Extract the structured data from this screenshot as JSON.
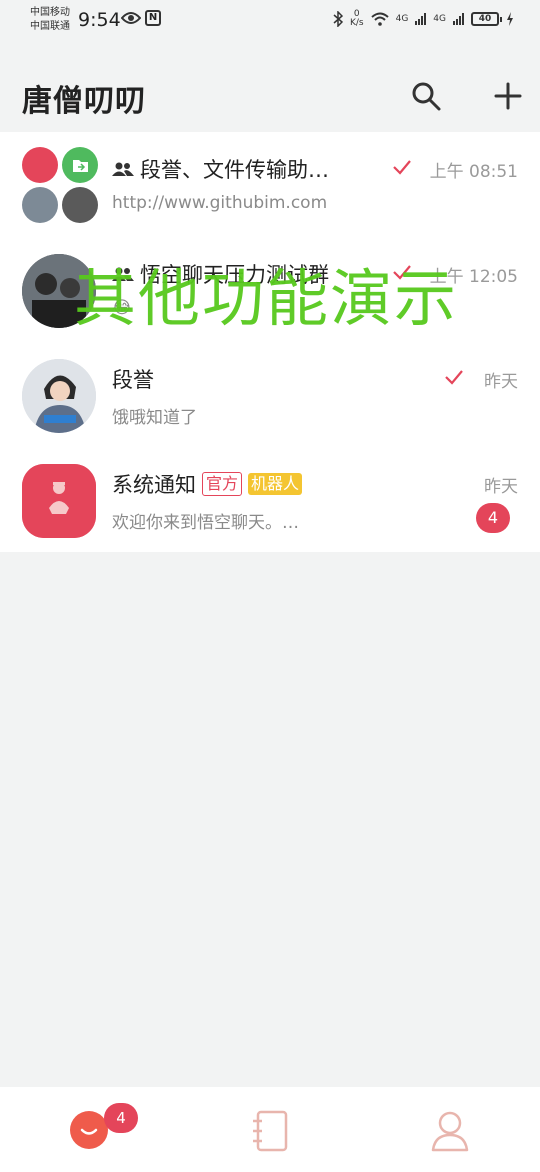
{
  "status_bar": {
    "carrier_1": "中国移动",
    "carrier_2": "中国联通",
    "time": "9:54",
    "nfc": "N",
    "net_speed_value": "0",
    "net_speed_unit": "K/s",
    "net_1": "4G",
    "net_2": "4G",
    "battery": "40"
  },
  "header": {
    "title": "唐僧叨叨",
    "search_icon": "search-icon",
    "add_icon": "add-icon"
  },
  "conversations": [
    {
      "name": "段誉、文件传输助…",
      "preview": "http://www.githubim.com",
      "time": "上午 08:51",
      "read": true,
      "group": true
    },
    {
      "name": "悟空聊天压力测试群",
      "preview": "😂",
      "time": "上午 12:05",
      "read": true,
      "group": true
    },
    {
      "name": "段誉",
      "preview": "饿哦知道了",
      "time": "昨天",
      "read": true,
      "group": false
    },
    {
      "name": "系统通知",
      "tag_official": "官方",
      "tag_robot": "机器人",
      "preview": "欢迎你来到悟空聊天。…",
      "time": "昨天",
      "unread": "4"
    }
  ],
  "overlay_text": "其他功能演示",
  "tab_bar": {
    "chat_badge": "4",
    "tabs": [
      "chat-icon",
      "contacts-icon",
      "profile-icon"
    ]
  },
  "colors": {
    "accent": "#e4455a",
    "robot_tag": "#f4c531",
    "overlay": "#57c91d",
    "background": "#f2f3f3"
  }
}
